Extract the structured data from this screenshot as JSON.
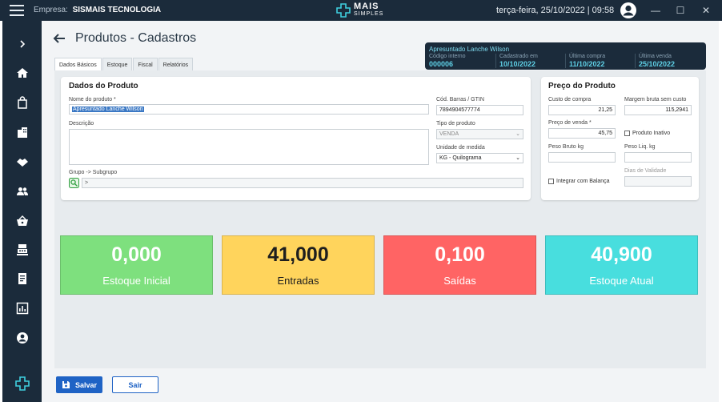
{
  "topbar": {
    "empresa_label": "Empresa:",
    "empresa_name": "SISMAIS TECNOLOGIA",
    "logo_line1": "MAIS",
    "logo_line2": "SIMPLES",
    "datetime": "terça-feira, 25/10/2022 | 09:58"
  },
  "sidebar": {
    "items": [
      {
        "icon": "chevron-right-icon"
      },
      {
        "icon": "home-icon"
      },
      {
        "icon": "shopping-bag-icon"
      },
      {
        "icon": "building-icon"
      },
      {
        "icon": "handshake-icon"
      },
      {
        "icon": "users-icon"
      },
      {
        "icon": "basket-icon"
      },
      {
        "icon": "cash-register-icon"
      },
      {
        "icon": "document-icon"
      },
      {
        "icon": "report-chart-icon"
      },
      {
        "icon": "account-icon"
      },
      {
        "icon": "logo-cross-icon"
      }
    ]
  },
  "page": {
    "title": "Produtos - Cadastros"
  },
  "tabs": [
    "Dados Básicos",
    "Estoque",
    "Fiscal",
    "Relatórios"
  ],
  "info": {
    "product_name": "Apresuntado Lanche Wilson",
    "codigo_label": "Código interno",
    "codigo_value": "000006",
    "cadastrado_label": "Cadastrado em",
    "cadastrado_value": "10/10/2022",
    "ultima_compra_label": "Última compra",
    "ultima_compra_value": "11/10/2022",
    "ultima_venda_label": "Última venda",
    "ultima_venda_value": "25/10/2022"
  },
  "dados": {
    "heading": "Dados do Produto",
    "nome_label": "Nome do produto *",
    "nome_value": "Apresuntado Lanche Wilson",
    "descricao_label": "Descrição",
    "descricao_value": "",
    "grupo_label": "Grupo -> Subgrupo",
    "grupo_value": ">",
    "codbarras_label": "Cód. Barras / GTIN",
    "codbarras_value": "7894904577774",
    "tipo_label": "Tipo de produto",
    "tipo_value": "VENDA",
    "unidade_label": "Unidade de medida",
    "unidade_value": "KG - Quilograma"
  },
  "preco": {
    "heading": "Preço do Produto",
    "custo_label": "Custo de compra",
    "custo_value": "21,25",
    "margem_label": "Margem bruta sem custo",
    "margem_value": "115,2941",
    "venda_label": "Preço de venda *",
    "venda_value": "45,75",
    "inativo_label": "Produto Inativo",
    "peso_bruto_label": "Peso Bruto kg",
    "peso_bruto_value": "",
    "peso_liq_label": "Peso Liq. kg",
    "peso_liq_value": "",
    "balanca_label": "Integrar com Balança",
    "validade_label": "Dias de Validade",
    "validade_value": ""
  },
  "stats": [
    {
      "value": "0,000",
      "label": "Estoque Inicial",
      "bg": "#7ee07e",
      "color": "#ffffff"
    },
    {
      "value": "41,000",
      "label": "Entradas",
      "bg": "#ffd45c",
      "color": "#1e1e1e"
    },
    {
      "value": "0,100",
      "label": "Saídas",
      "bg": "#ff6464",
      "color": "#ffffff"
    },
    {
      "value": "40,900",
      "label": "Estoque Atual",
      "bg": "#48dede",
      "color": "#ffffff"
    }
  ],
  "buttons": {
    "save": "Salvar",
    "exit": "Sair"
  },
  "colors": {
    "accent": "#1f63c5",
    "dark": "#1b2b3b",
    "info_text": "#5fd0e6"
  }
}
